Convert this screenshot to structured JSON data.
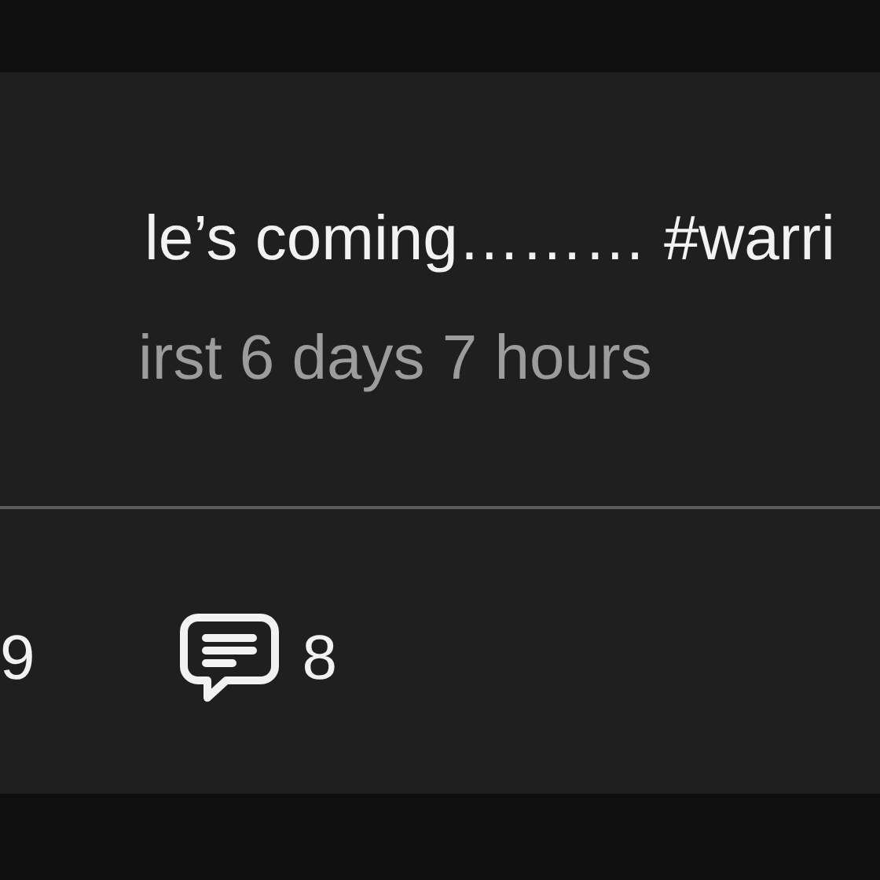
{
  "post": {
    "text": "le’s coming……… #warri",
    "meta": "irst 6 days 7 hours"
  },
  "actions": [
    {
      "kind": "plain",
      "count": "9"
    },
    {
      "kind": "comments",
      "count": "8"
    }
  ]
}
